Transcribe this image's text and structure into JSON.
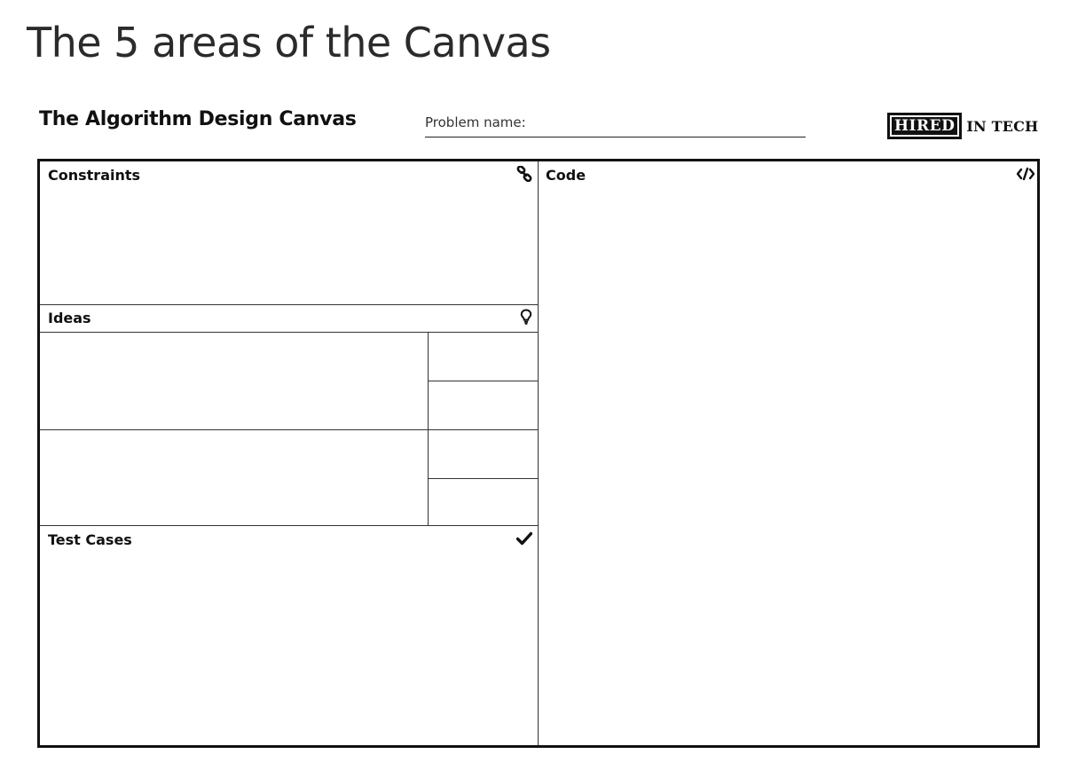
{
  "page": {
    "heading": "The 5 areas of the Canvas"
  },
  "canvas": {
    "title": "The Algorithm Design Canvas",
    "problem_name_label": "Problem name:",
    "logo": {
      "boxed_text": "HIRED",
      "text": "IN TECH"
    },
    "sections": {
      "constraints": {
        "label": "Constraints",
        "icon": "link-icon"
      },
      "ideas": {
        "label": "Ideas",
        "icon": "lightbulb-icon"
      },
      "test_cases": {
        "label": "Test Cases",
        "icon": "checkmark-icon"
      },
      "code": {
        "label": "Code",
        "icon": "code-icon"
      }
    }
  }
}
